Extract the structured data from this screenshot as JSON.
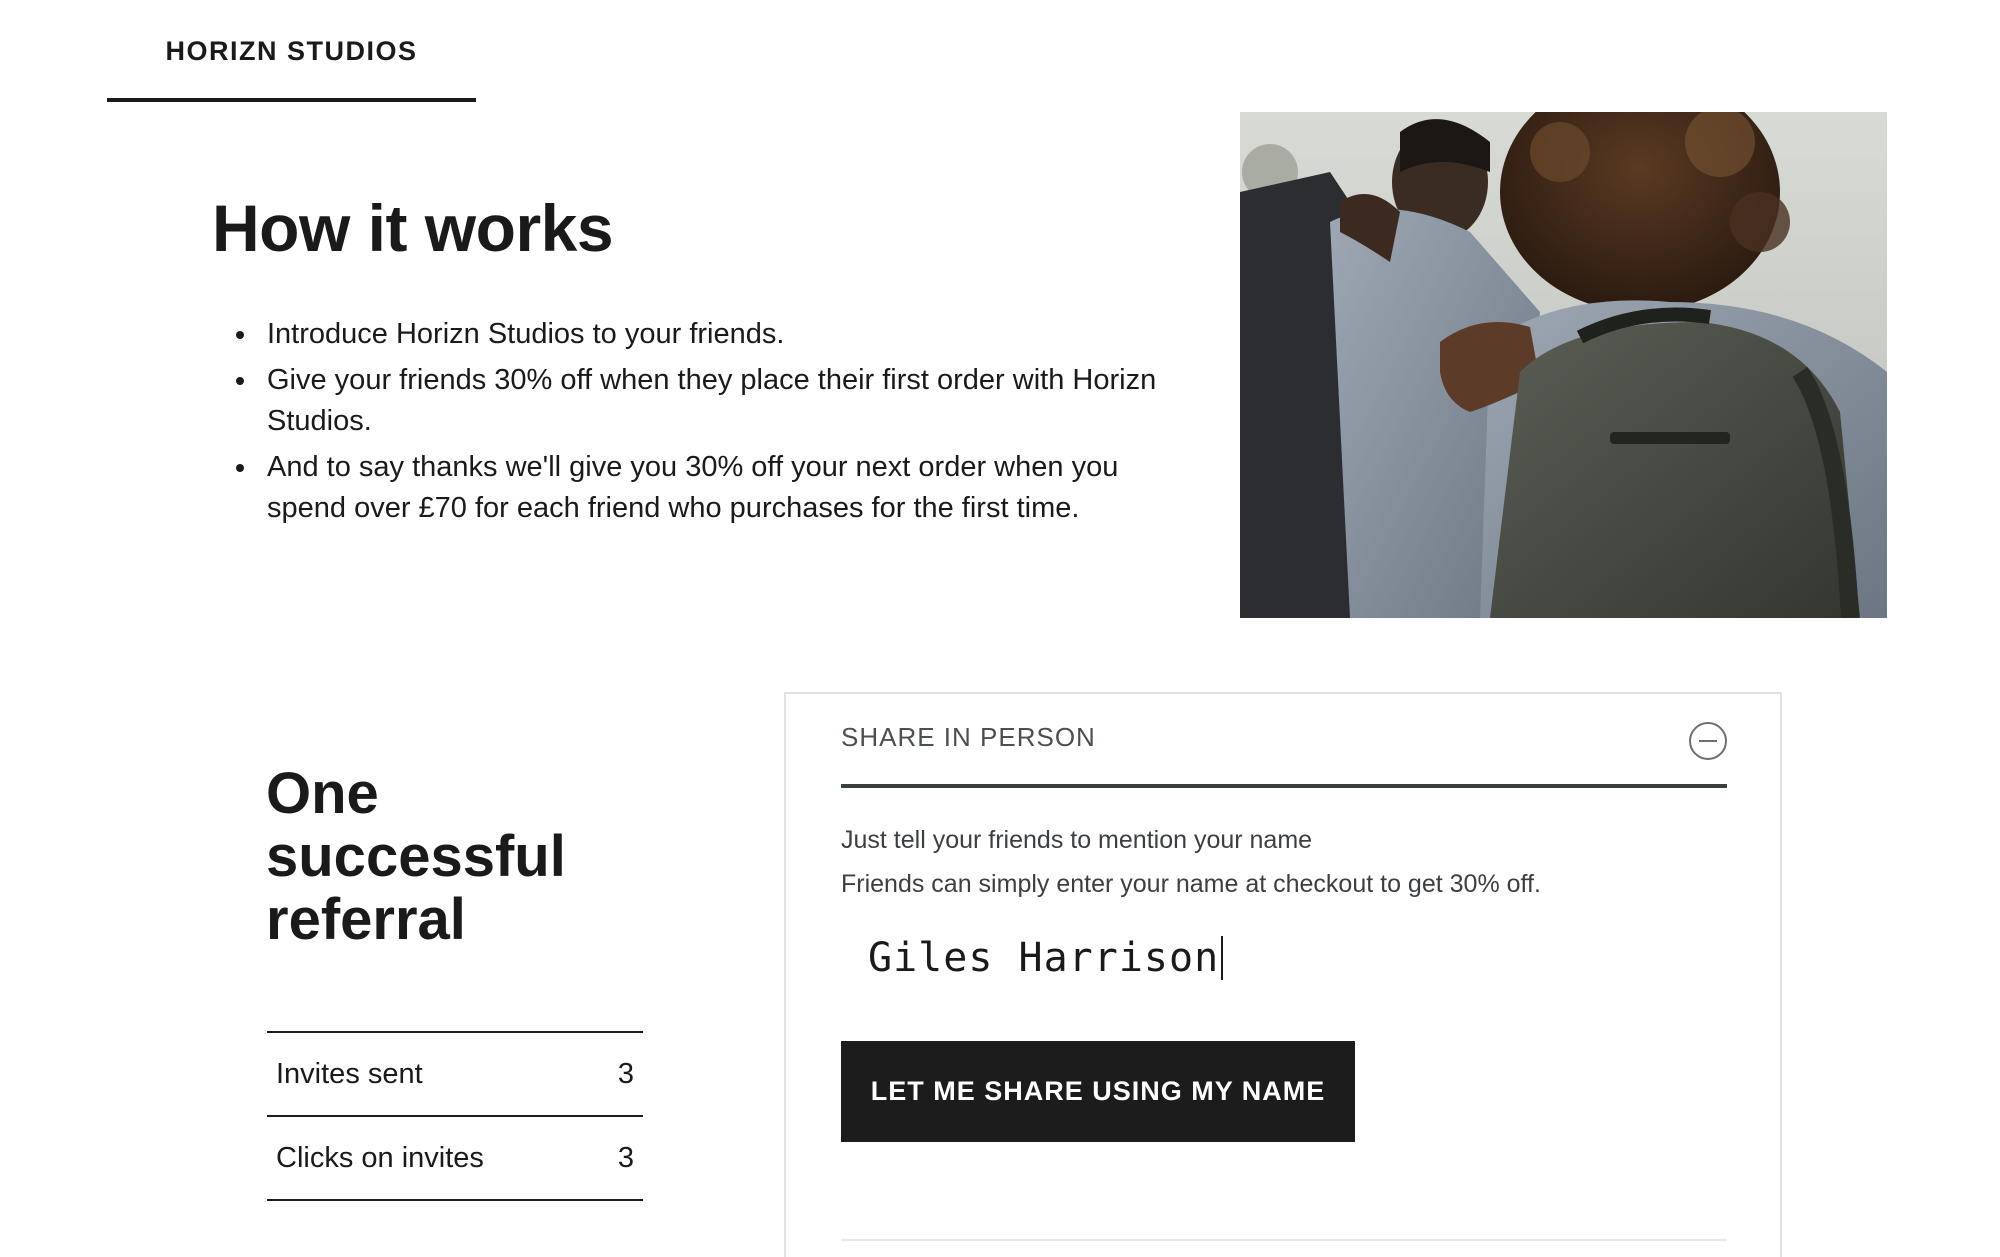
{
  "header": {
    "brand_tab": "HORIZN STUDIOS"
  },
  "how_it_works": {
    "title": "How it works",
    "bullets": [
      "Introduce Horizn Studios to your friends.",
      "Give your friends 30% off when they place their first order with Horizn Studios.",
      "And to say thanks we'll give you 30% off your next order when you spend over £70 for each friend who purchases for the first time."
    ]
  },
  "referral": {
    "title": "One successful referral",
    "stats": [
      {
        "label": "Invites sent",
        "value": "3"
      },
      {
        "label": "Clicks on invites",
        "value": "3"
      }
    ]
  },
  "share_panel": {
    "title": "SHARE IN PERSON",
    "desc_line1": "Just tell your friends to mention your name",
    "desc_line2": "Friends can simply enter your name at checkout to get 30% off.",
    "name_value": "Giles Harrison",
    "button_label": "LET ME SHARE USING MY NAME",
    "collapse_icon": "minus-circle-icon"
  },
  "colors": {
    "text": "#1a1a1a",
    "button_bg": "#1c1c1c",
    "panel_border": "#e2e2e2",
    "header_rule": "#3a3f42"
  }
}
